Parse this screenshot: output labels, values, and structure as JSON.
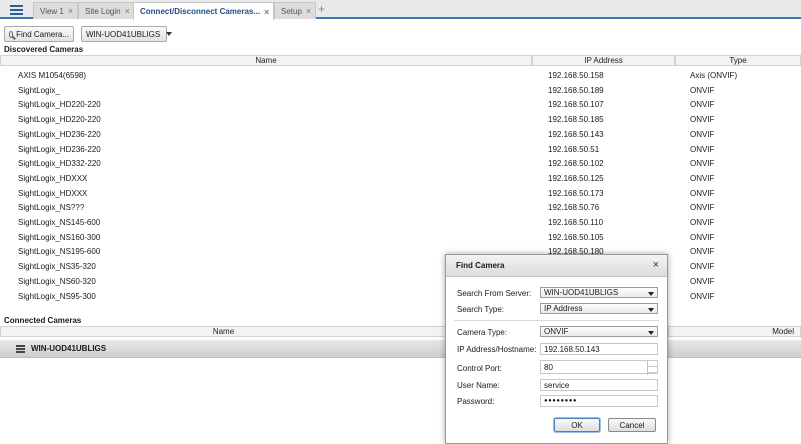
{
  "tabs": [
    {
      "label": "View 1"
    },
    {
      "label": "Site Login"
    },
    {
      "label": "Connect/Disconnect Cameras..."
    },
    {
      "label": "Setup"
    }
  ],
  "tab_close_glyph": "×",
  "tab_add_glyph": "+",
  "toolbar": {
    "find_camera_label": "Find Camera...",
    "server_select_value": "WIN-UOD41UBLIGS"
  },
  "discovered": {
    "title": "Discovered Cameras",
    "columns": {
      "name": "Name",
      "ip": "IP Address",
      "type": "Type"
    },
    "rows": [
      {
        "name": "AXIS M1054(6598)",
        "ip": "192.168.50.158",
        "type": "Axis (ONVIF)"
      },
      {
        "name": "SightLogix_",
        "ip": "192.168.50.189",
        "type": "ONVIF"
      },
      {
        "name": "SightLogix_HD220-220",
        "ip": "192.168.50.107",
        "type": "ONVIF"
      },
      {
        "name": "SightLogix_HD220-220",
        "ip": "192.168.50.185",
        "type": "ONVIF"
      },
      {
        "name": "SightLogix_HD236-220",
        "ip": "192.168.50.143",
        "type": "ONVIF"
      },
      {
        "name": "SightLogix_HD236-220",
        "ip": "192.168.50.51",
        "type": "ONVIF"
      },
      {
        "name": "SightLogix_HD332-220",
        "ip": "192.168.50.102",
        "type": "ONVIF"
      },
      {
        "name": "SightLogix_HDXXX",
        "ip": "192.168.50.125",
        "type": "ONVIF"
      },
      {
        "name": "SightLogix_HDXXX",
        "ip": "192.168.50.173",
        "type": "ONVIF"
      },
      {
        "name": "SightLogix_NS???",
        "ip": "192.168.50.76",
        "type": "ONVIF"
      },
      {
        "name": "SightLogix_NS145-600",
        "ip": "192.168.50.110",
        "type": "ONVIF"
      },
      {
        "name": "SightLogix_NS160-300",
        "ip": "192.168.50.105",
        "type": "ONVIF"
      },
      {
        "name": "SightLogix_NS195-600",
        "ip": "192.168.50.180",
        "type": "ONVIF"
      },
      {
        "name": "SightLogix_NS35-320",
        "ip": "",
        "type": "ONVIF"
      },
      {
        "name": "SightLogix_NS60-320",
        "ip": "",
        "type": "ONVIF"
      },
      {
        "name": "SightLogix_NS95-300",
        "ip": "",
        "type": "ONVIF"
      }
    ]
  },
  "connected": {
    "title": "Connected Cameras",
    "columns": {
      "name": "Name",
      "model": "Model"
    },
    "server_group": "WIN-UOD41UBLIGS"
  },
  "dialog": {
    "title": "Find Camera",
    "close_glyph": "×",
    "search_from_server_label": "Search From Server:",
    "search_from_server_value": "WIN-UOD41UBLIGS",
    "search_type_label": "Search Type:",
    "search_type_value": "IP Address",
    "camera_type_label": "Camera Type:",
    "camera_type_value": "ONVIF",
    "ip_label": "IP Address/Hostname:",
    "ip_value": "192.168.50.143",
    "port_label": "Control Port:",
    "port_value": "80",
    "user_label": "User Name:",
    "user_value": "service",
    "password_label": "Password:",
    "password_value": "●●●●●●●●",
    "ok_label": "OK",
    "cancel_label": "Cancel"
  },
  "colors": {
    "accent": "#3c77b5",
    "active_tab_text": "#1f4f87"
  }
}
